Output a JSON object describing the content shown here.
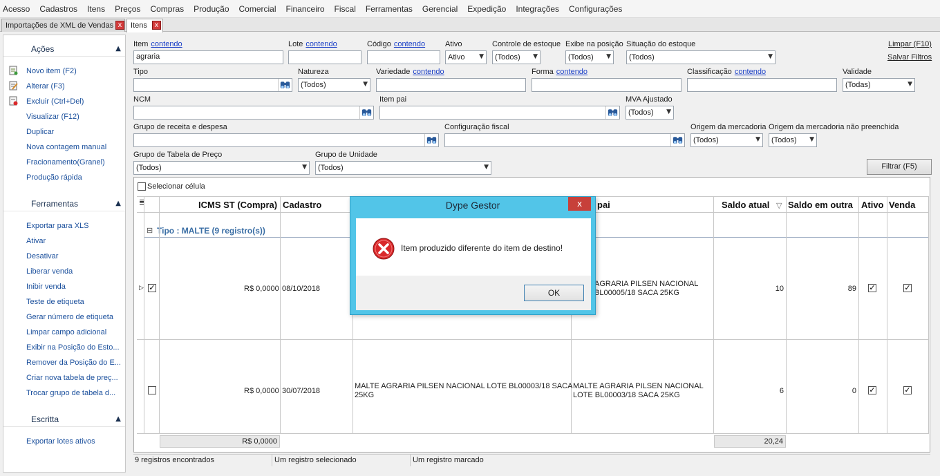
{
  "menu": [
    "Acesso",
    "Cadastros",
    "Itens",
    "Preços",
    "Compras",
    "Produção",
    "Comercial",
    "Financeiro",
    "Fiscal",
    "Ferramentas",
    "Gerencial",
    "Expedição",
    "Integrações",
    "Configurações"
  ],
  "tabs": [
    {
      "label": "Importações de XML de Vendas",
      "close": "x"
    },
    {
      "label": "Itens",
      "close": "x"
    }
  ],
  "sidebar": {
    "acoes_title": "Ações",
    "acoes": [
      "Novo item (F2)",
      "Alterar (F3)",
      "Excluir (Ctrl+Del)",
      "Visualizar (F12)",
      "Duplicar",
      "Nova contagem manual",
      "Fracionamento(Granel)",
      "Produção rápida"
    ],
    "ferramentas_title": "Ferramentas",
    "ferramentas": [
      "Exportar para XLS",
      "Ativar",
      "Desativar",
      "Liberar venda",
      "Inibir venda",
      "Teste de etiqueta",
      "Gerar número de etiqueta",
      "Limpar campo adicional",
      "Exibir na Posição do Esto...",
      "Remover da Posição do E...",
      "Criar nova tabela de preç...",
      "Trocar grupo de tabela d..."
    ],
    "escrita_title": "Escritta",
    "escrita": [
      "Exportar lotes ativos"
    ],
    "chevron": "▲"
  },
  "filters": {
    "contendo": "contendo",
    "item": {
      "label": "Item",
      "value": "agraria"
    },
    "lote": {
      "label": "Lote"
    },
    "codigo": {
      "label": "Código"
    },
    "ativo": {
      "label": "Ativo",
      "value": "Ativo"
    },
    "controle": {
      "label": "Controle de estoque",
      "value": "(Todos)"
    },
    "exibe": {
      "label": "Exibe na posição",
      "value": "(Todos)"
    },
    "situacao": {
      "label": "Situação do estoque",
      "value": "(Todos)"
    },
    "limpar": "Limpar (F10)",
    "salvar": "Salvar Filtros",
    "tipo": {
      "label": "Tipo"
    },
    "natureza": {
      "label": "Natureza",
      "value": "(Todos)"
    },
    "variedade": {
      "label": "Variedade"
    },
    "forma": {
      "label": "Forma"
    },
    "classificacao": {
      "label": "Classificação"
    },
    "validade": {
      "label": "Validade",
      "value": "(Todas)"
    },
    "ncm": {
      "label": "NCM"
    },
    "item_pai": {
      "label": "Item pai"
    },
    "mva": {
      "label": "MVA Ajustado",
      "value": "(Todos)"
    },
    "grupo_receita": {
      "label": "Grupo de receita e despesa"
    },
    "config_fiscal": {
      "label": "Configuração fiscal"
    },
    "origem": {
      "label": "Origem da mercadoria",
      "value": "(Todos)"
    },
    "origem_np": {
      "label": "Origem da mercadoria não preenchida",
      "value": "(Todos)"
    },
    "grupo_tabela": {
      "label": "Grupo de Tabela de Preço",
      "value": "(Todos)"
    },
    "grupo_unidade": {
      "label": "Grupo de Unidade",
      "value": "(Todos)"
    },
    "filtrar": "Filtrar (F5)"
  },
  "grid": {
    "selecionar": "Selecionar célula",
    "headers": {
      "icms": "ICMS ST (Compra)",
      "cadastro": "Cadastro",
      "pai": "pai",
      "saldo": "Saldo atual",
      "saldo_outra": "Saldo em outra",
      "ativo": "Ativo",
      "venda": "Venda"
    },
    "group": "Tipo : MALTE (9 registro(s))",
    "group_toggle": "⊟",
    "rows": [
      {
        "icms": "R$ 0,0000",
        "cadastro": "08/10/2018",
        "desc": "",
        "pai_line1": "AGRARIA PILSEN NACIONAL",
        "pai_line2": "BL00005/18 SACA 25KG",
        "saldo": "10",
        "saldo_outra": "89",
        "checked": true
      },
      {
        "icms": "R$ 0,0000",
        "cadastro": "30/07/2018",
        "desc_line1": "MALTE AGRARIA PILSEN NACIONAL LOTE BL00003/18 SACA",
        "desc_line2": "25KG",
        "pai_line1": "MALTE AGRARIA PILSEN NACIONAL",
        "pai_line2": "LOTE BL00003/18 SACA 25KG",
        "saldo": "6",
        "saldo_outra": "0",
        "checked": false
      }
    ],
    "footer_icms": "R$ 0,0000",
    "footer_saldo": "20,24"
  },
  "status": [
    "9 registros encontrados",
    "Um registro selecionado",
    "Um registro marcado"
  ],
  "dialog": {
    "title": "Dype Gestor",
    "close": "x",
    "message": "Item produzido diferente do item de destino!",
    "ok": "OK"
  },
  "colors": {
    "accent_link": "#1a3fc7",
    "dialog_frame": "#52c5e8",
    "error_icon": "#d9282a"
  }
}
